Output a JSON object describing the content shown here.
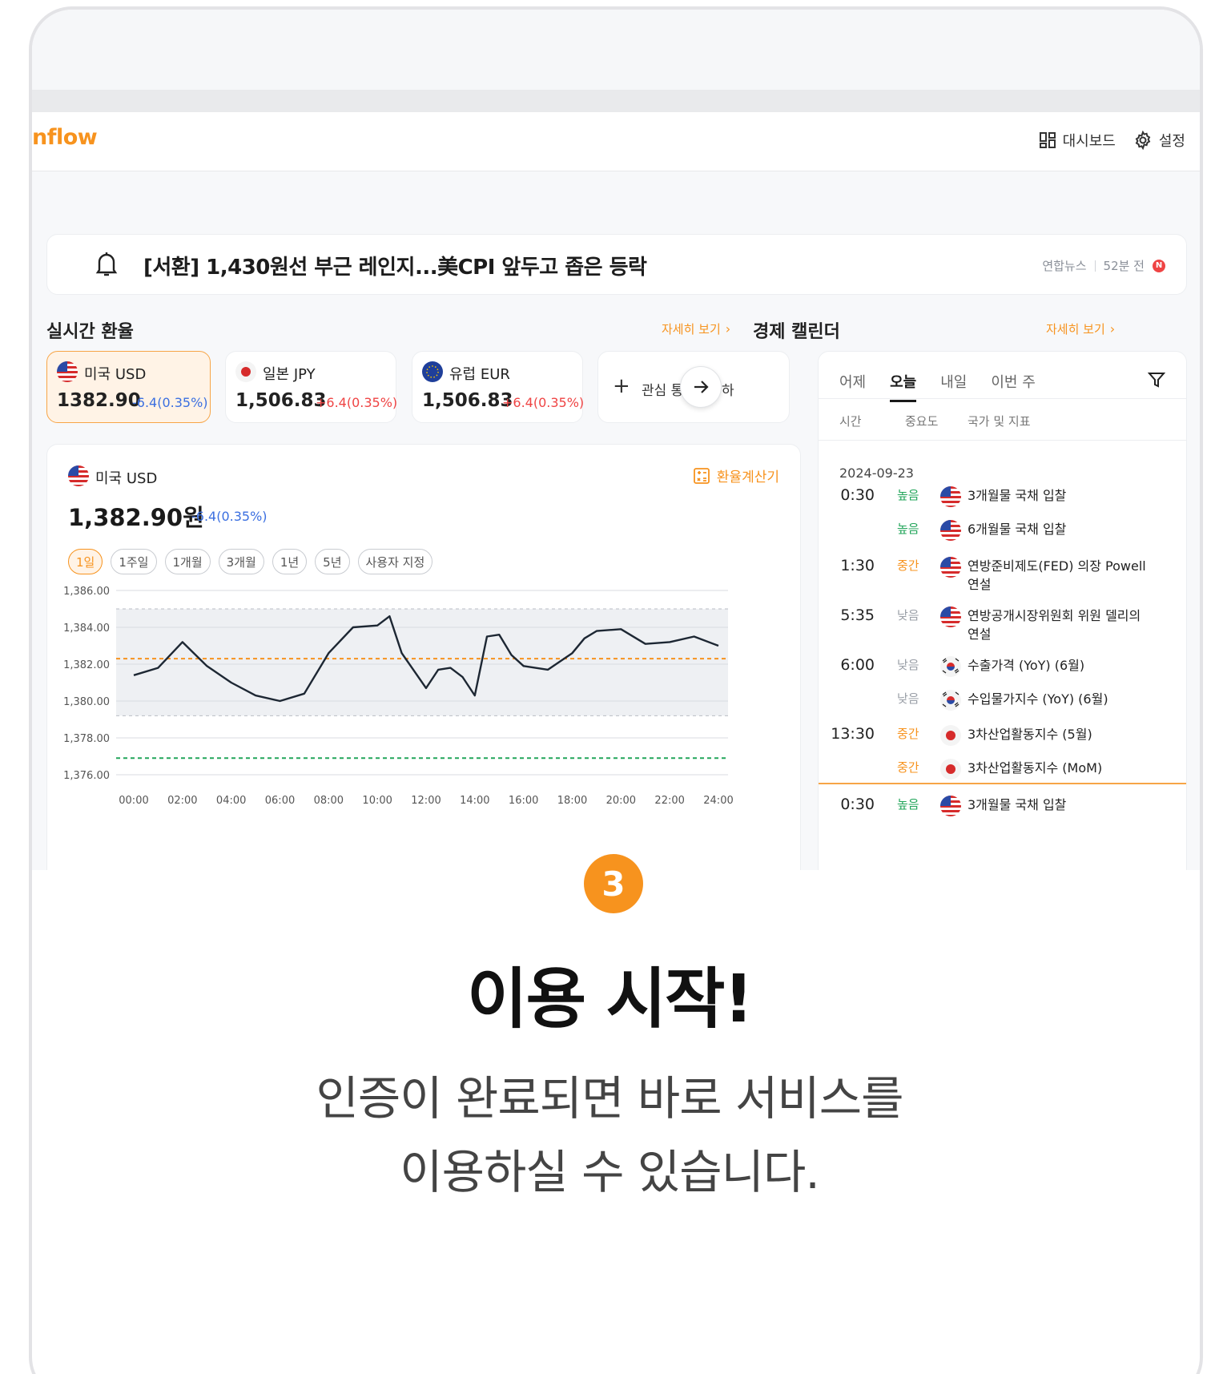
{
  "app": {
    "logo": "nflow",
    "nav": [
      {
        "label": "대시보드",
        "icon": "dashboard-icon"
      },
      {
        "label": "설정",
        "icon": "gear-icon"
      }
    ]
  },
  "ticker": {
    "headline": "[서환] 1,430원선 부근 레인지...美CPI 앞두고 좁은 등락",
    "source": "연합뉴스",
    "time": "52분 전",
    "badge": "N"
  },
  "rates": {
    "title": "실시간 환율",
    "more": "자세히 보기",
    "cards": [
      {
        "name": "미국 USD",
        "value": "1382.90",
        "change": "-6.4(0.35%)",
        "flag": "us-flag-icon"
      },
      {
        "name": "일본 JPY",
        "value": "1,506.83",
        "change": "+6.4(0.35%)",
        "flag": "jp-flag-icon"
      },
      {
        "name": "유럽 EUR",
        "value": "1,506.83",
        "change": "+6.4(0.35%)",
        "flag": "eu-flag-icon"
      }
    ],
    "add_label": "관심 통",
    "add_label_tail": "하"
  },
  "detail": {
    "currency": "미국 USD",
    "calc_label": "환율계산기",
    "rate": "1,382.90원",
    "change": "-6.4(0.35%)",
    "periods": [
      "1일",
      "1주일",
      "1개월",
      "3개월",
      "1년",
      "5년",
      "사용자 지정"
    ],
    "active_period": "1일"
  },
  "chart_data": {
    "type": "line",
    "x": [
      "00:00",
      "01:00",
      "02:00",
      "03:00",
      "04:00",
      "05:00",
      "06:00",
      "07:00",
      "08:00",
      "09:00",
      "10:00",
      "10:30",
      "11:00",
      "12:00",
      "12:30",
      "13:00",
      "13:30",
      "14:00",
      "14:30",
      "15:00",
      "15:30",
      "16:00",
      "17:00",
      "18:00",
      "18:30",
      "19:00",
      "20:00",
      "21:00",
      "22:00",
      "23:00",
      "24:00"
    ],
    "tick_labels": [
      "00:00",
      "02:00",
      "04:00",
      "06:00",
      "08:00",
      "10:00",
      "12:00",
      "14:00",
      "16:00",
      "18:00",
      "20:00",
      "22:00",
      "24:00"
    ],
    "series": [
      {
        "values": [
          1381.4,
          1381.8,
          1383.2,
          1381.9,
          1381.0,
          1380.3,
          1380.0,
          1380.4,
          1382.6,
          1384.0,
          1384.1,
          1384.6,
          1382.6,
          1380.7,
          1381.7,
          1381.8,
          1381.3,
          1380.3,
          1383.5,
          1383.6,
          1382.5,
          1381.9,
          1381.7,
          1382.6,
          1383.4,
          1383.8,
          1383.9,
          1383.1,
          1383.2,
          1383.5,
          1383.0
        ]
      }
    ],
    "reference_lines": [
      {
        "value": 1382.3,
        "color": "#f7931e",
        "style": "dashed"
      },
      {
        "value": 1376.9,
        "color": "#22a55a",
        "style": "dashed"
      }
    ],
    "band": [
      1379.2,
      1385.0
    ],
    "ylim": [
      1376.0,
      1386.0
    ],
    "yticks": [
      "1,386.00",
      "1,384.00",
      "1,382.00",
      "1,380.00",
      "1,378.00",
      "1,376.00"
    ],
    "grid": true
  },
  "calendar": {
    "title": "경제 캘린더",
    "more": "자세히 보기",
    "tabs": [
      "어제",
      "오늘",
      "내일",
      "이번 주"
    ],
    "active_tab": "오늘",
    "columns": [
      "시간",
      "중요도",
      "국가 및 지표"
    ],
    "date": "2024-09-23",
    "events": [
      {
        "time": "0:30",
        "importance": "높음",
        "level": "high",
        "flag": "us-flag-icon",
        "text": "3개월물 국채 입찰"
      },
      {
        "time": "",
        "importance": "높음",
        "level": "high",
        "flag": "us-flag-icon",
        "text": "6개월물 국채 입찰"
      },
      {
        "time": "1:30",
        "importance": "중간",
        "level": "mid",
        "flag": "us-flag-icon",
        "text": "연방준비제도(FED) 의장 Powell 연설"
      },
      {
        "time": "5:35",
        "importance": "낮음",
        "level": "low",
        "flag": "us-flag-icon",
        "text": "연방공개시장위원회 위원 델리의 연설"
      },
      {
        "time": "6:00",
        "importance": "낮음",
        "level": "low",
        "flag": "kr-flag-icon",
        "text": "수출가격 (YoY) (6월)"
      },
      {
        "time": "",
        "importance": "낮음",
        "level": "low",
        "flag": "kr-flag-icon",
        "text": "수입물가지수 (YoY) (6월)"
      },
      {
        "time": "13:30",
        "importance": "중간",
        "level": "mid",
        "flag": "jp-flag-icon",
        "text": "3차산업활동지수 (5월)"
      },
      {
        "time": "",
        "importance": "중간",
        "level": "mid",
        "flag": "jp-flag-icon",
        "text": "3차산업활동지수 (MoM)"
      },
      {
        "time": "0:30",
        "importance": "높음",
        "level": "high",
        "flag": "us-flag-icon",
        "text": "3개월물 국채 입찰"
      }
    ]
  },
  "onboarding": {
    "step": "3",
    "title": "이용 시작!",
    "line1": "인증이 완료되면 바로 서비스를",
    "line2": "이용하실 수 있습니다."
  },
  "colors": {
    "accent": "#f7931e",
    "negative": "#3b6fe0",
    "positive": "#ef4444",
    "importance_high": "#22a55a"
  }
}
